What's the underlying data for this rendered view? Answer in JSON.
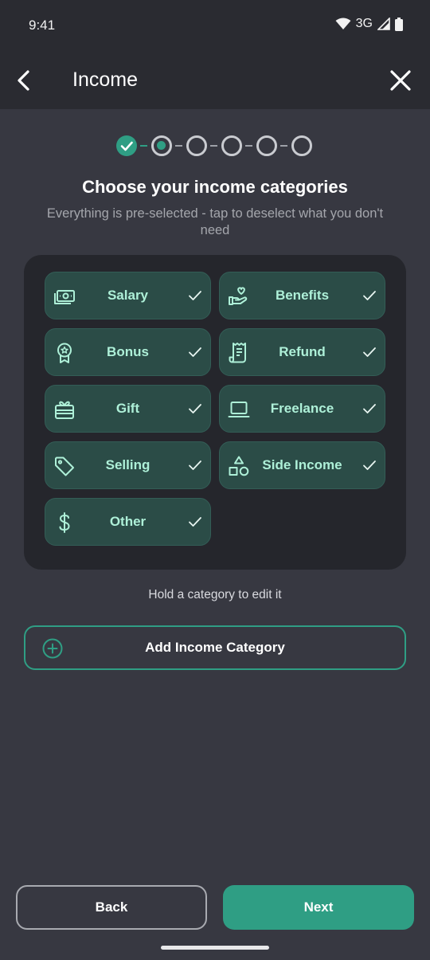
{
  "status_bar": {
    "time": "9:41",
    "network": "3G"
  },
  "app_bar": {
    "title": "Income"
  },
  "stepper": {
    "total_steps": 6,
    "current_step": 2,
    "completed_steps": 1
  },
  "heading": "Choose your income categories",
  "subheading": "Everything is pre-selected - tap to deselect what you don't need",
  "categories": [
    {
      "label": "Salary",
      "icon": "cash-icon",
      "selected": true
    },
    {
      "label": "Benefits",
      "icon": "hand-heart-icon",
      "selected": true
    },
    {
      "label": "Bonus",
      "icon": "award-icon",
      "selected": true
    },
    {
      "label": "Refund",
      "icon": "receipt-icon",
      "selected": true
    },
    {
      "label": "Gift",
      "icon": "gift-icon",
      "selected": true
    },
    {
      "label": "Freelance",
      "icon": "laptop-icon",
      "selected": true
    },
    {
      "label": "Selling",
      "icon": "tag-icon",
      "selected": true
    },
    {
      "label": "Side Income",
      "icon": "shapes-icon",
      "selected": true
    },
    {
      "label": "Other",
      "icon": "dollar-icon",
      "selected": true
    }
  ],
  "hint": "Hold a category to edit it",
  "add_button": {
    "label": "Add Income Category"
  },
  "footer": {
    "back_label": "Back",
    "next_label": "Next"
  },
  "colors": {
    "accent": "#2f9e84",
    "chip_bg": "#2b4c47",
    "chip_text": "#aef0d8",
    "background": "#373841"
  }
}
